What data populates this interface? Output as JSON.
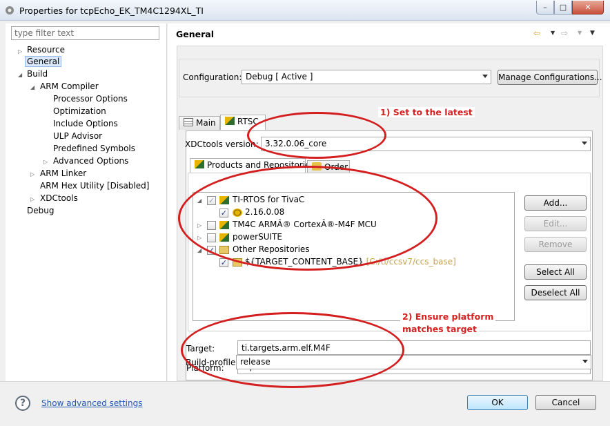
{
  "window": {
    "title": "Properties for tcpEcho_EK_TM4C1294XL_TI",
    "minimize": "–",
    "maximize": "□",
    "close": "✕"
  },
  "left": {
    "filter_placeholder": "type filter text",
    "tree": [
      "Resource",
      "General",
      "Build",
      "ARM Compiler",
      "Processor Options",
      "Optimization",
      "Include Options",
      "ULP Advisor",
      "Predefined Symbols",
      "Advanced Options",
      "ARM Linker",
      "ARM Hex Utility  [Disabled]",
      "XDCtools",
      "Debug"
    ],
    "selected": "General"
  },
  "page": {
    "title": "General"
  },
  "config": {
    "label": "Configuration:",
    "value": "Debug  [ Active ]",
    "manage_button": "Manage Configurations..."
  },
  "tabs": {
    "main": "Main",
    "rtsc": "RTSC"
  },
  "rtsc": {
    "xdctools_label": "XDCtools version:",
    "xdctools_value": "3.32.0.06_core",
    "subtabs": {
      "products": "Products and Repositories",
      "order": "Order"
    },
    "repos": [
      {
        "label": "TI-RTOS for TivaC",
        "checked": true
      },
      {
        "label": "2.16.0.08",
        "checked": true
      },
      {
        "label": "TM4C ARMÂ® CortexÂ®-M4F MCU",
        "checked": false
      },
      {
        "label": "powerSUITE",
        "checked": false
      },
      {
        "label": "Other Repositories",
        "checked": true
      },
      {
        "label": "${TARGET_CONTENT_BASE}",
        "path": "[C:/ti/ccsv7/ccs_base]",
        "checked": true
      }
    ],
    "buttons": {
      "add": "Add...",
      "edit": "Edit...",
      "remove": "Remove",
      "select_all": "Select All",
      "deselect_all": "Deselect All"
    },
    "target_label": "Target:",
    "target_value": "ti.targets.arm.elf.M4F",
    "platform_label": "Platform:",
    "platform_value": "ti.platforms.tiva:TM4C1294NCPDT",
    "build_profile_label": "Build-profile:",
    "build_profile_value": "release"
  },
  "annotations": {
    "note1": "1) Set to the latest",
    "note2_line1": "2) Ensure platform",
    "note2_line2": "matches target"
  },
  "bottom": {
    "help": "?",
    "advanced_link": "Show advanced settings",
    "ok": "OK",
    "cancel": "Cancel"
  },
  "colors": {
    "annotation": "#d31f1f",
    "link": "#2358b0",
    "path": "#c4a24a"
  }
}
